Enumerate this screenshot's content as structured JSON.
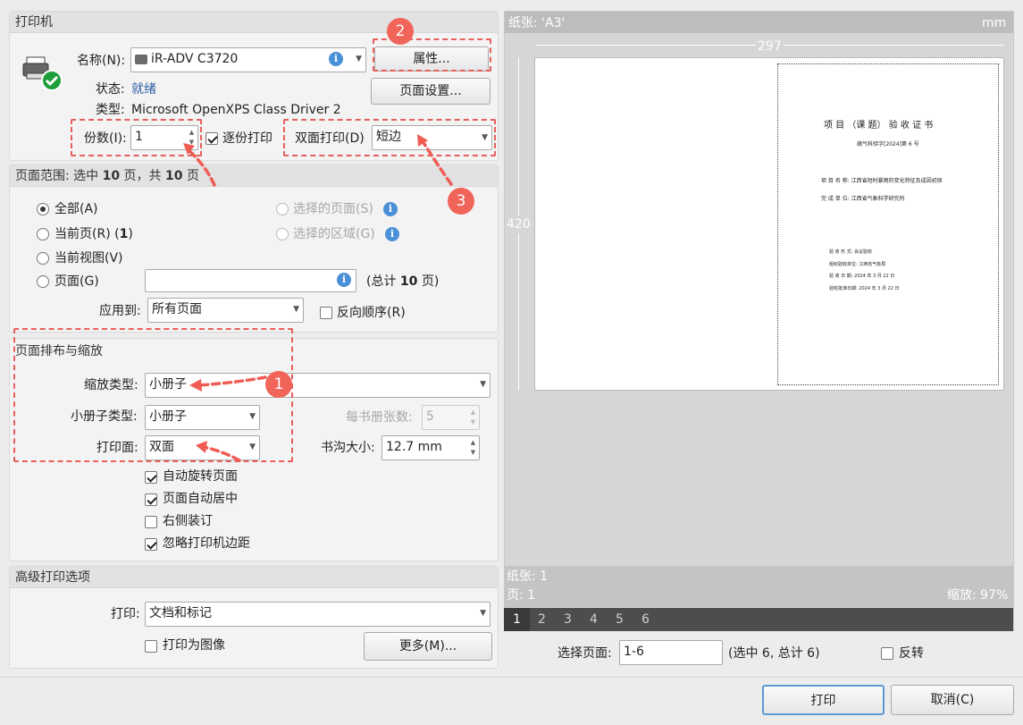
{
  "printer": {
    "section_title": "打印机",
    "name_label": "名称(N):",
    "name_value": "iR-ADV C3720",
    "properties_button": "属性...",
    "page_setup_button": "页面设置...",
    "status_label": "状态:",
    "status_value": "就绪",
    "type_label": "类型:",
    "type_value": "Microsoft OpenXPS Class Driver 2",
    "copies_label": "份数(I):",
    "copies_value": "1",
    "collate_label": "逐份打印",
    "duplex_label": "双面打印(D)",
    "duplex_value": "短边"
  },
  "page_range": {
    "title_prefix": "页面范围: 选中 ",
    "selected": "10",
    "title_mid": " 页，共 ",
    "total": "10",
    "title_suffix": " 页",
    "all": "全部(A)",
    "current_page": "当前页(R) (",
    "current_page_num": "1",
    "current_page_close": ")",
    "current_view": "当前视图(V)",
    "pages": "页面(G)",
    "pages_total_prefix": "(总计 ",
    "pages_total": "10",
    "pages_total_suffix": " 页)",
    "selected_pages": "选择的页面(S)",
    "selected_area": "选择的区域(G)",
    "apply_to_label": "应用到:",
    "apply_to_value": "所有页面",
    "reverse_label": "反向顺序(R)"
  },
  "layout": {
    "title": "页面排布与缩放",
    "scale_type_label": "缩放类型:",
    "scale_type_value": "小册子",
    "booklet_type_label": "小册子类型:",
    "booklet_type_value": "小册子",
    "sheets_per_booklet_label": "每书册张数:",
    "sheets_per_booklet_value": "5",
    "print_side_label": "打印面:",
    "print_side_value": "双面",
    "gutter_label": "书沟大小:",
    "gutter_value": "12.7 mm",
    "auto_rotate": "自动旋转页面",
    "auto_center": "页面自动居中",
    "right_binding": "右侧装订",
    "ignore_margins": "忽略打印机边距"
  },
  "advanced": {
    "title": "高级打印选项",
    "print_label": "打印:",
    "print_value": "文档和标记",
    "print_as_image": "打印为图像",
    "more_button": "更多(M)..."
  },
  "preview": {
    "paper_label": "纸张: 'A3'",
    "unit": "mm",
    "width": "297",
    "height": "420",
    "sheet_info": "纸张: 1",
    "page_info": "页: 1",
    "zoom": "缩放: 97%",
    "tabs": [
      "1",
      "2",
      "3",
      "4",
      "5",
      "6"
    ],
    "select_pages_label": "选择页面:",
    "select_pages_value": "1-6",
    "select_info": "(选中 6, 总计 6)",
    "invert_label": "反转"
  },
  "document": {
    "title": "项 目 （课 题） 验 收 证 书",
    "doc_no": "赣气科验字[2024]第 6 号",
    "project_name": "项 目 名 称:   江西省短时暴雨的变化特征及成因初探",
    "unit": "完 成 单 位:   江西省气象科学研究所",
    "r1": "验 收 形 式:       会议验收",
    "r2": "组织验收单位:     江西省气象局",
    "r3": "验 收 日 期:      2024 年 3 月 22 日",
    "r4": "验收批准日期:     2024 年 3 月 22 日"
  },
  "annotations": [
    "1",
    "2",
    "3"
  ],
  "buttons": {
    "print": "打印",
    "cancel": "取消(C)"
  }
}
